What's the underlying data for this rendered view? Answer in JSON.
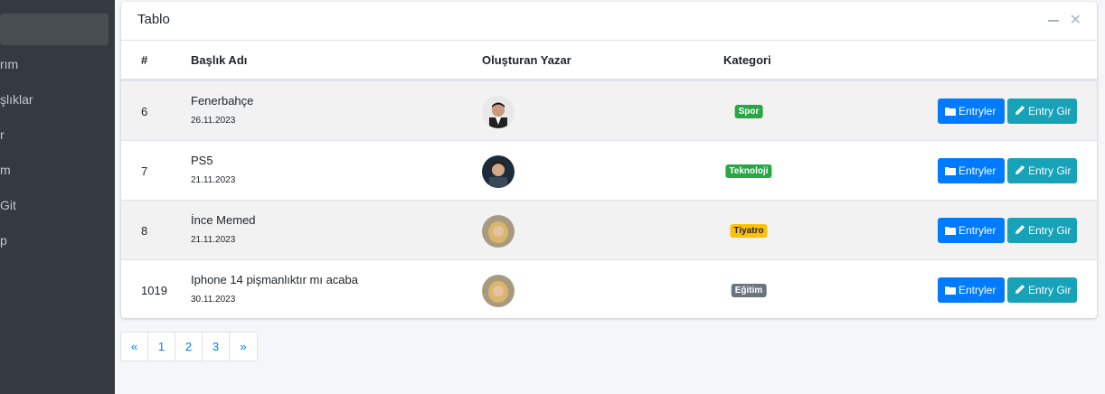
{
  "sidebar": {
    "items": [
      {
        "label": "rım"
      },
      {
        "label": "şlıklar"
      },
      {
        "label": "r"
      },
      {
        "label": "m"
      },
      {
        "label": "Git"
      },
      {
        "label": "p"
      }
    ]
  },
  "card": {
    "title": "Tablo",
    "columns": [
      "#",
      "Başlık Adı",
      "Oluşturan Yazar",
      "Kategori"
    ]
  },
  "rows": [
    {
      "id": "6",
      "title": "Fenerbahçe",
      "date": "26.11.2023",
      "category": "Spor",
      "category_color": "#28a745",
      "category_text_color": "#ffffff"
    },
    {
      "id": "7",
      "title": "PS5",
      "date": "21.11.2023",
      "category": "Teknoloji",
      "category_color": "#28a745",
      "category_text_color": "#ffffff"
    },
    {
      "id": "8",
      "title": "İnce Memed",
      "date": "21.11.2023",
      "category": "Tiyatro",
      "category_color": "#ffc107",
      "category_text_color": "#212529"
    },
    {
      "id": "1019",
      "title": "Iphone 14 pişmanlıktır mı acaba",
      "date": "30.11.2023",
      "category": "Eğitim",
      "category_color": "#6c757d",
      "category_text_color": "#ffffff"
    }
  ],
  "actions": {
    "entries_label": "Entryler",
    "entries_icon": "folder-icon",
    "entry_write_label": "Entry Gir",
    "entry_write_icon": "pencil-icon"
  },
  "pagination": [
    "«",
    "1",
    "2",
    "3",
    "»"
  ],
  "colors": {
    "primary": "#007bff",
    "info": "#17a2b8",
    "sidebar": "#343a40"
  }
}
